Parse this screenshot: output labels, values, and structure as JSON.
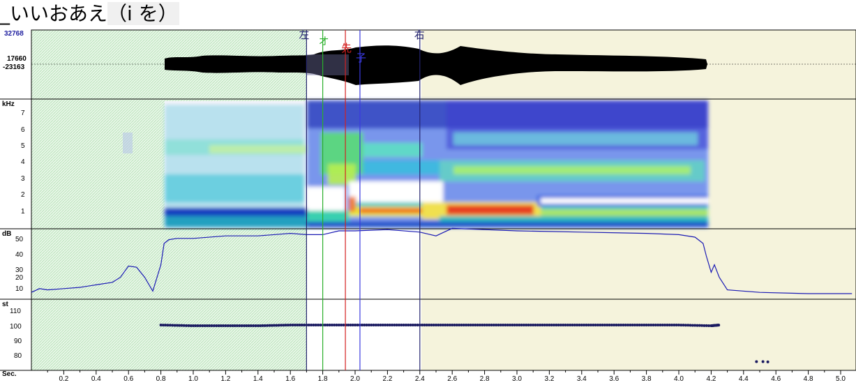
{
  "title": {
    "label": "_いいおあえ",
    "rest": "（i を）"
  },
  "colors": {
    "left_region": "#d4f2d4",
    "right_region": "#f5f3dc",
    "marker_left": "#24246e",
    "marker_o": "#2ab02a",
    "marker_saki": "#d42020",
    "marker_ko": "#3a3ae0",
    "marker_right": "#24246e",
    "db_curve": "#1a1ab4",
    "pitch_dots": "#1a1a60"
  },
  "waveform": {
    "max_label": "32768",
    "upper_label": "17660",
    "lower_label": "-23163"
  },
  "spectrogram": {
    "unit": "kHz",
    "ticks": [
      "7",
      "6",
      "5",
      "4",
      "3",
      "2",
      "1"
    ]
  },
  "intensity": {
    "unit": "dB",
    "ticks": [
      "50",
      "40",
      "30",
      "20",
      "10"
    ]
  },
  "pitch": {
    "unit": "st",
    "ticks": [
      "110",
      "100",
      "90",
      "80"
    ]
  },
  "time_axis": {
    "unit": "Sec.",
    "ticks": [
      "0.2",
      "0.4",
      "0.6",
      "0.8",
      "1.0",
      "1.2",
      "1.4",
      "1.6",
      "1.8",
      "2.0",
      "2.2",
      "2.4",
      "2.6",
      "2.8",
      "3.0",
      "3.2",
      "3.4",
      "3.6",
      "3.8",
      "4.0",
      "4.2",
      "4.4",
      "4.6",
      "4.8",
      "5.0"
    ]
  },
  "markers": [
    {
      "label": "左",
      "time": 1.7,
      "color": "#24246e"
    },
    {
      "label": "オ",
      "time": 1.8,
      "color": "#2ab02a"
    },
    {
      "label": "先",
      "time": 1.94,
      "color": "#d42020"
    },
    {
      "label": "子",
      "time": 2.03,
      "color": "#3a3ae0"
    },
    {
      "label": "右",
      "time": 2.4,
      "color": "#24246e"
    }
  ],
  "chart_data": {
    "type": "line",
    "xlabel": "Sec.",
    "xlim": [
      0,
      5.07
    ],
    "intensity_db": {
      "x": [
        0.0,
        0.05,
        0.1,
        0.2,
        0.3,
        0.4,
        0.5,
        0.55,
        0.6,
        0.65,
        0.7,
        0.75,
        0.8,
        0.82,
        0.85,
        0.9,
        1.0,
        1.2,
        1.4,
        1.6,
        1.7,
        1.8,
        1.9,
        2.0,
        2.2,
        2.4,
        2.5,
        2.6,
        2.8,
        3.0,
        3.4,
        3.8,
        4.0,
        4.1,
        4.15,
        4.17,
        4.2,
        4.22,
        4.25,
        4.3,
        4.5,
        4.8,
        5.07
      ],
      "y": [
        6,
        9,
        8,
        9,
        10,
        12,
        14,
        18,
        27,
        26,
        18,
        7,
        28,
        45,
        48,
        49,
        49,
        51,
        51,
        53,
        52,
        52,
        55,
        55,
        56,
        54,
        51,
        57,
        56,
        55,
        54,
        53,
        52,
        50,
        45,
        35,
        22,
        28,
        18,
        8,
        6,
        5,
        5
      ]
    },
    "pitch_st": {
      "x": [
        0.8,
        1.0,
        1.2,
        1.4,
        1.6,
        1.8,
        2.0,
        2.2,
        2.4,
        2.6,
        2.8,
        3.0,
        3.2,
        3.4,
        3.6,
        3.8,
        4.0,
        4.2,
        4.25
      ],
      "y": [
        100,
        99.5,
        99.5,
        99.5,
        100,
        100,
        100,
        100,
        100,
        100,
        100,
        100,
        100,
        100,
        100,
        100,
        100,
        99.5,
        100
      ],
      "extra_points": [
        [
          4.48,
          75
        ],
        [
          4.52,
          75
        ],
        [
          4.55,
          74.8
        ]
      ]
    }
  }
}
